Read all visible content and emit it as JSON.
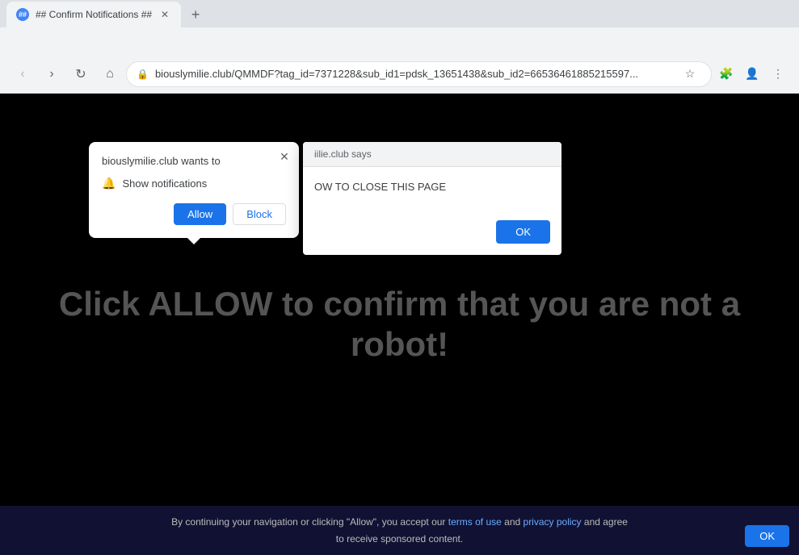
{
  "browser": {
    "title": "## Confirm Notifications ##",
    "url": "biouslymilie.club/QMMDF?tag_id=7371228&sub_id1=pdsk_13651438&sub_id2=665364618852155978&cookie_id=ffac83d3-5c3f-4940-8201...",
    "url_short": "biouslymilie.club/QMMDF?tag_id=7371228&sub_id1=pdsk_13651438&sub_id2=66536461885215597...",
    "new_tab_label": "+",
    "nav": {
      "back": "‹",
      "forward": "›",
      "reload": "↻",
      "home": "⌂"
    },
    "window_controls": {
      "minimize": "—",
      "maximize": "□",
      "close": "✕"
    }
  },
  "notification_popup": {
    "title": "biouslymilie.club wants to",
    "close_icon": "✕",
    "bell_icon": "🔔",
    "show_notifications_label": "Show notifications",
    "allow_label": "Allow",
    "block_label": "Block"
  },
  "site_dialog": {
    "header": "iilie.club says",
    "message": "OW TO CLOSE THIS PAGE",
    "ok_label": "OK"
  },
  "page": {
    "main_text": "Click ALLOW to confirm that you are not a robot!",
    "bottom_notice": "By continuing your navigation or clicking \"Allow\", you accept our",
    "terms_label": "terms of use",
    "and_label": "and",
    "privacy_label": "privacy policy",
    "agree_text": "and agree\nto receive sponsored content.",
    "ok_btn_label": "OK"
  }
}
